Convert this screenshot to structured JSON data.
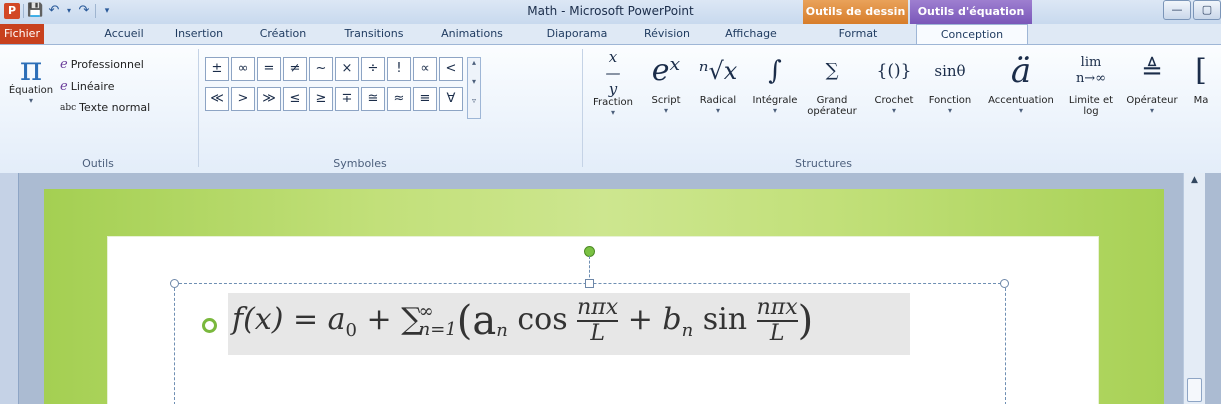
{
  "window": {
    "title": "Math  -  Microsoft PowerPoint",
    "context_tabs": {
      "drawing": "Outils de dessin",
      "equation": "Outils d'équation"
    },
    "controls": {
      "minimize": "—",
      "maximize": "▢"
    }
  },
  "qat": {
    "logo": "P",
    "save_icon": "save-icon",
    "undo_icon": "undo-icon",
    "redo_icon": "redo-icon",
    "customize_icon": "customize-icon"
  },
  "tabs": [
    {
      "label": "Fichier"
    },
    {
      "label": "Accueil"
    },
    {
      "label": "Insertion"
    },
    {
      "label": "Création"
    },
    {
      "label": "Transitions"
    },
    {
      "label": "Animations"
    },
    {
      "label": "Diaporama"
    },
    {
      "label": "Révision"
    },
    {
      "label": "Affichage"
    },
    {
      "label": "Format"
    },
    {
      "label": "Conception"
    }
  ],
  "groups": {
    "outils": {
      "label": "Outils",
      "equation_label": "Équation",
      "options": [
        "Professionnel",
        "Linéaire",
        "Texte normal"
      ]
    },
    "symboles": {
      "label": "Symboles",
      "row1": [
        "±",
        "∞",
        "=",
        "≠",
        "~",
        "×",
        "÷",
        "!",
        "∝",
        "<"
      ],
      "row2": [
        "≪",
        ">",
        "≫",
        "≤",
        "≥",
        "∓",
        "≅",
        "≈",
        "≡",
        "∀"
      ]
    },
    "structures": {
      "label": "Structures",
      "items": [
        {
          "sym": "x/y",
          "label": "Fraction"
        },
        {
          "sym": "eˣ",
          "label": "Script"
        },
        {
          "sym": "ⁿ√x",
          "label": "Radical"
        },
        {
          "sym": "∫",
          "label": "Intégrale"
        },
        {
          "sym": "∑",
          "label": "Grand opérateur"
        },
        {
          "sym": "{()}",
          "label": "Crochet"
        },
        {
          "sym": "sinθ",
          "label": "Fonction"
        },
        {
          "sym": "ä",
          "label": "Accentuation"
        },
        {
          "sym": "lim n→∞",
          "label": "Limite et log"
        },
        {
          "sym": "≜",
          "label": "Opérateur"
        },
        {
          "sym": "[",
          "label": "Ma"
        }
      ]
    }
  },
  "slide": {
    "formula": "f(x) = a₀ + ∑ₙ₌₁^∞ ( aₙ cos nπx/L + bₙ sin nπx/L )",
    "formula_parts": {
      "f": "f(x) = a",
      "sub0": "0",
      "plus": " + ∑",
      "inf": "∞",
      "n1": "n=1",
      "an": "(a",
      "nsub": "n",
      "cos": " cos ",
      "num": "nπx",
      "den": "L",
      "plus2": " + b",
      "sin": " sin ",
      "close": ")"
    }
  },
  "colors": {
    "accent_green": "#7ab83d",
    "ribbon_file": "#c8411e",
    "equation_ctx": "#7a57b9"
  }
}
